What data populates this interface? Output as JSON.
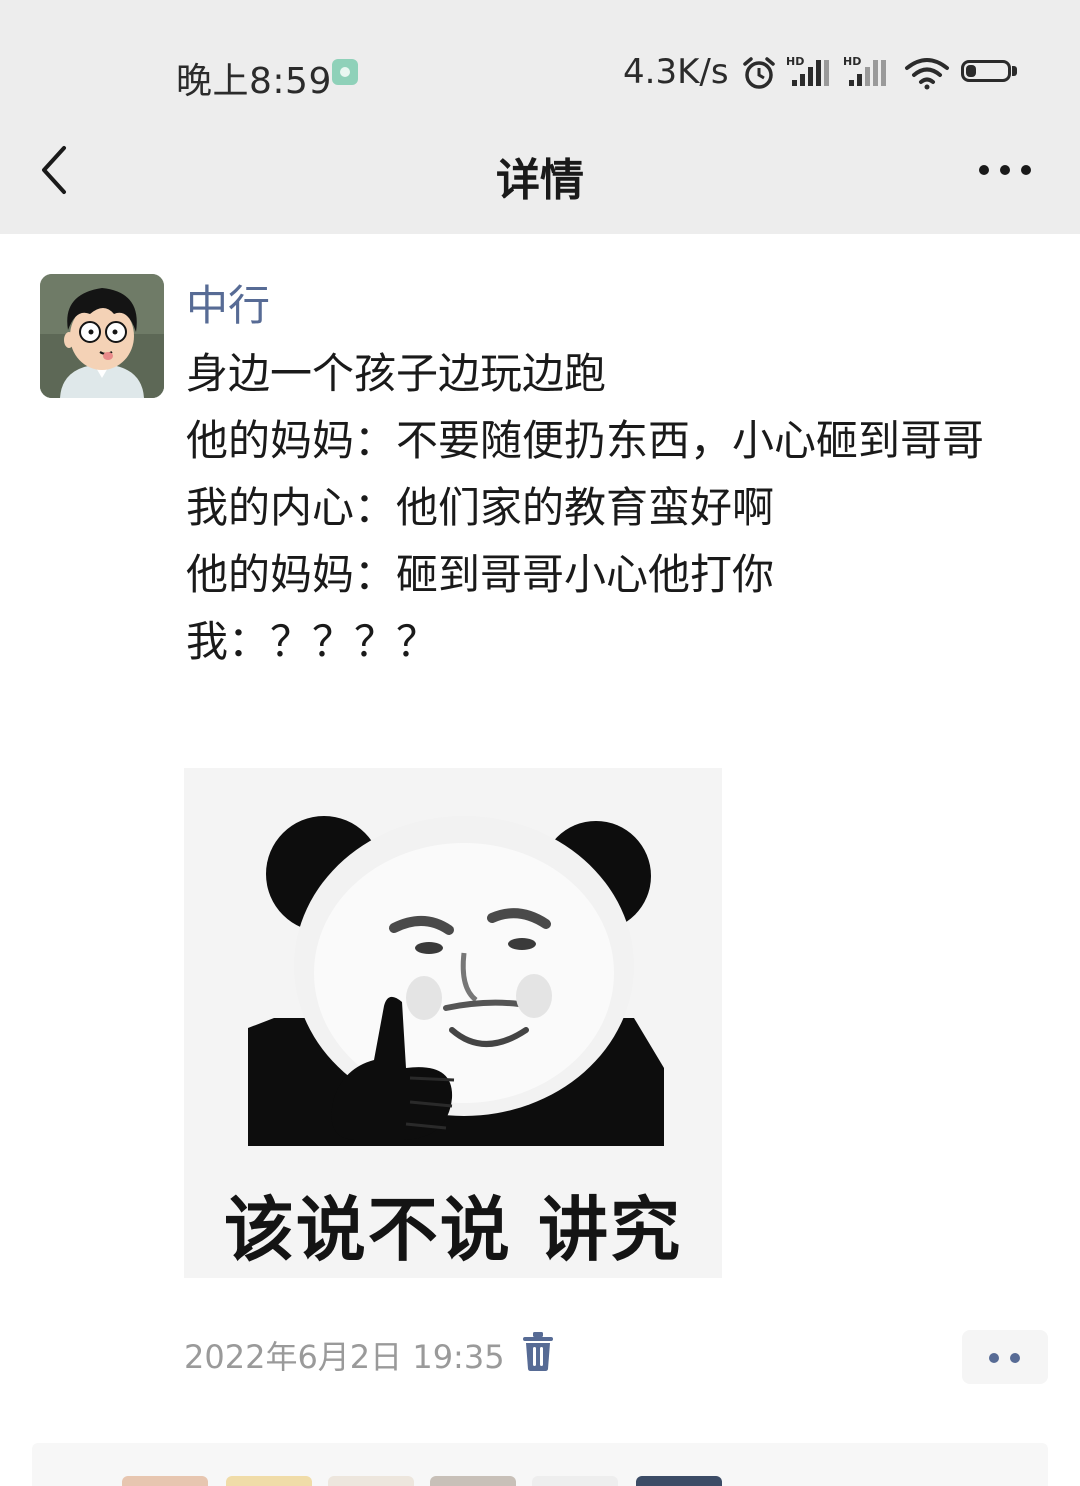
{
  "status_bar": {
    "time": "晚上8:59",
    "net_speed": "4.3K/s",
    "battery_level": "24",
    "battery_fraction": 0.24,
    "icons": [
      "app-notification-icon",
      "alarm-icon",
      "hd-signal-icon",
      "hd-signal-icon",
      "wifi-icon",
      "battery-icon"
    ]
  },
  "nav": {
    "title": "详情",
    "back_icon": "chevron-left-icon",
    "more_icon": "more-horizontal-icon"
  },
  "post": {
    "author": "中行",
    "lines": [
      "身边一个孩子边玩边跑",
      "他的妈妈：不要随便扔东西，小心砸到哥哥",
      "我的内心：他们家的教育蛮好啊",
      "他的妈妈：砸到哥哥小心他打你",
      "我：？？？？"
    ],
    "image_caption": "该说不说 讲究",
    "timestamp": "2022年6月2日 19:35",
    "delete_icon": "trash-icon",
    "more_icon": "more-dots-icon"
  },
  "colors": {
    "link_blue": "#576b95",
    "header_bg": "#ededed",
    "timestamp_gray": "#9a9a9a"
  }
}
